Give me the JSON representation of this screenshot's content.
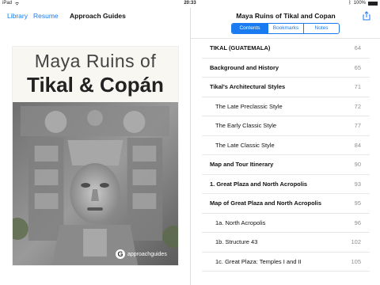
{
  "status": {
    "device": "iPad",
    "time": "20:33",
    "battery": "100%"
  },
  "left": {
    "nav": {
      "library": "Library",
      "resume": "Resume",
      "title": "Approach Guides"
    },
    "cover": {
      "title_line1": "Maya Ruins of",
      "title_line2": "Tikal & Copán",
      "brand": "approachguides"
    }
  },
  "right": {
    "title": "Maya Ruins of Tikal and Copan",
    "segments": [
      "Contents",
      "Bookmarks",
      "Notes"
    ],
    "toc": [
      {
        "label": "TIKAL (GUATEMALA)",
        "page": "64",
        "style": "bold"
      },
      {
        "label": "Background and History",
        "page": "65",
        "style": "bold"
      },
      {
        "label": "Tikal's Architectural Styles",
        "page": "71",
        "style": "bold"
      },
      {
        "label": "The Late Preclassic Style",
        "page": "72",
        "style": "sub"
      },
      {
        "label": "The Early Classic Style",
        "page": "77",
        "style": "sub"
      },
      {
        "label": "The Late Classic Style",
        "page": "84",
        "style": "sub"
      },
      {
        "label": "Map and Tour Itinerary",
        "page": "90",
        "style": "bold"
      },
      {
        "label": "1. Great Plaza and North Acropolis",
        "page": "93",
        "style": "bold"
      },
      {
        "label": "Map of Great Plaza and North Acropolis",
        "page": "95",
        "style": "bold"
      },
      {
        "label": "1a. North Acropolis",
        "page": "96",
        "style": "sub"
      },
      {
        "label": "1b. Structure 43",
        "page": "102",
        "style": "sub"
      },
      {
        "label": "1c. Great Plaza: Temples I and II",
        "page": "105",
        "style": "sub"
      }
    ]
  },
  "colors": {
    "accent": "#1a7bf0",
    "page_number": "#8e8e8e"
  }
}
